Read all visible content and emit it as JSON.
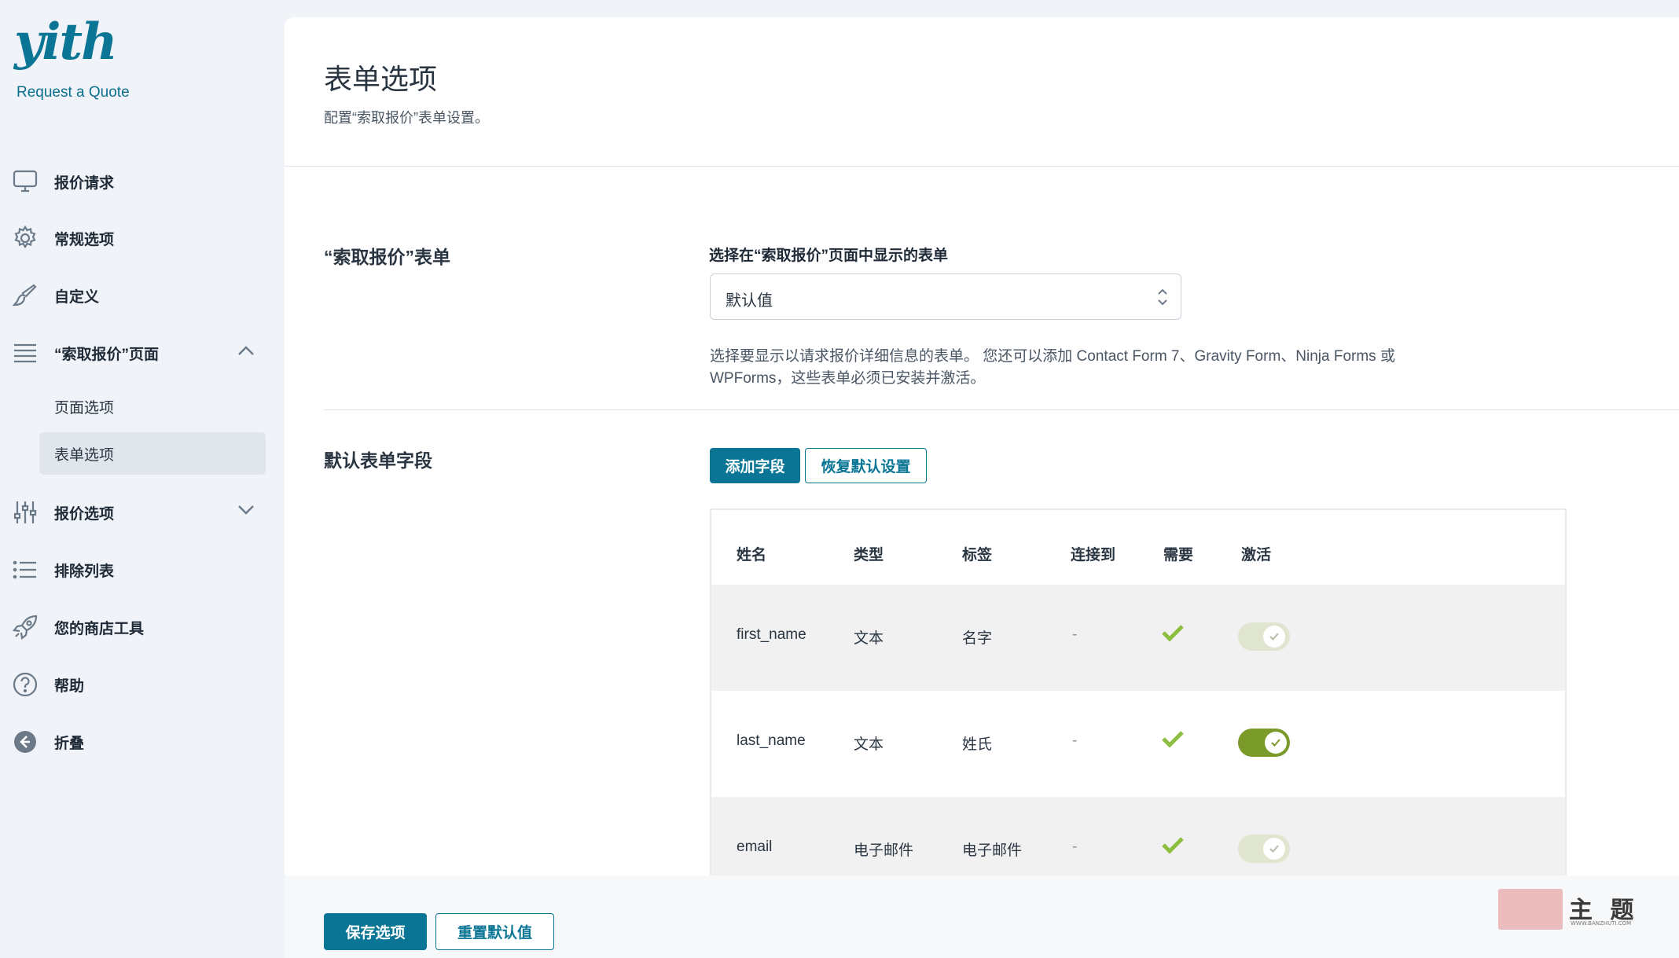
{
  "app": {
    "logo": "yith",
    "subtitle": "Request a Quote"
  },
  "sidebar": {
    "items": [
      {
        "label": "报价请求",
        "icon": "monitor-icon"
      },
      {
        "label": "常规选项",
        "icon": "gear-icon"
      },
      {
        "label": "自定义",
        "icon": "brush-icon"
      },
      {
        "label": "“索取报价”页面",
        "icon": "list-icon"
      },
      {
        "label": "报价选项",
        "icon": "sliders-icon"
      },
      {
        "label": "排除列表",
        "icon": "bullet-list-icon"
      },
      {
        "label": "您的商店工具",
        "icon": "rocket-icon"
      },
      {
        "label": "帮助",
        "icon": "help-icon"
      },
      {
        "label": "折叠",
        "icon": "collapse-arrow-icon"
      }
    ],
    "subitems": [
      {
        "label": "页面选项",
        "active": false
      },
      {
        "label": "表单选项",
        "active": true
      }
    ]
  },
  "page": {
    "title": "表单选项",
    "description": "配置“索取报价”表单设置。"
  },
  "form_section": {
    "title": "“索取报价”表单",
    "field_label": "选择在“索取报价”页面中显示的表单",
    "select_value": "默认值",
    "help_line1": "选择要显示以请求报价详细信息的表单。 您还可以添加 Contact Form 7、Gravity Form、Ninja Forms 或",
    "help_line2": "WPForms，这些表单必须已安装并激活。"
  },
  "fields_section": {
    "title": "默认表单字段",
    "add_button": "添加字段",
    "restore_button": "恢复默认设置",
    "columns": [
      "姓名",
      "类型",
      "标签",
      "连接到",
      "需要",
      "激活"
    ],
    "rows": [
      {
        "name": "first_name",
        "type": "文本",
        "label": "名字",
        "connect": "-",
        "required": true,
        "active": false
      },
      {
        "name": "last_name",
        "type": "文本",
        "label": "姓氏",
        "connect": "-",
        "required": true,
        "active": true
      },
      {
        "name": "email",
        "type": "电子邮件",
        "label": "电子邮件",
        "connect": "-",
        "required": true,
        "active": false
      }
    ]
  },
  "footer": {
    "save_button": "保存选项",
    "reset_button": "重置默认值"
  },
  "watermark": {
    "text": "主 题",
    "url": "WWW.BANZHUTI.COM"
  },
  "colors": {
    "accent": "#0a7594",
    "toggle_on": "#7a9a2a",
    "toggle_off": "#dfe5cf",
    "check": "#8cbf3f"
  }
}
